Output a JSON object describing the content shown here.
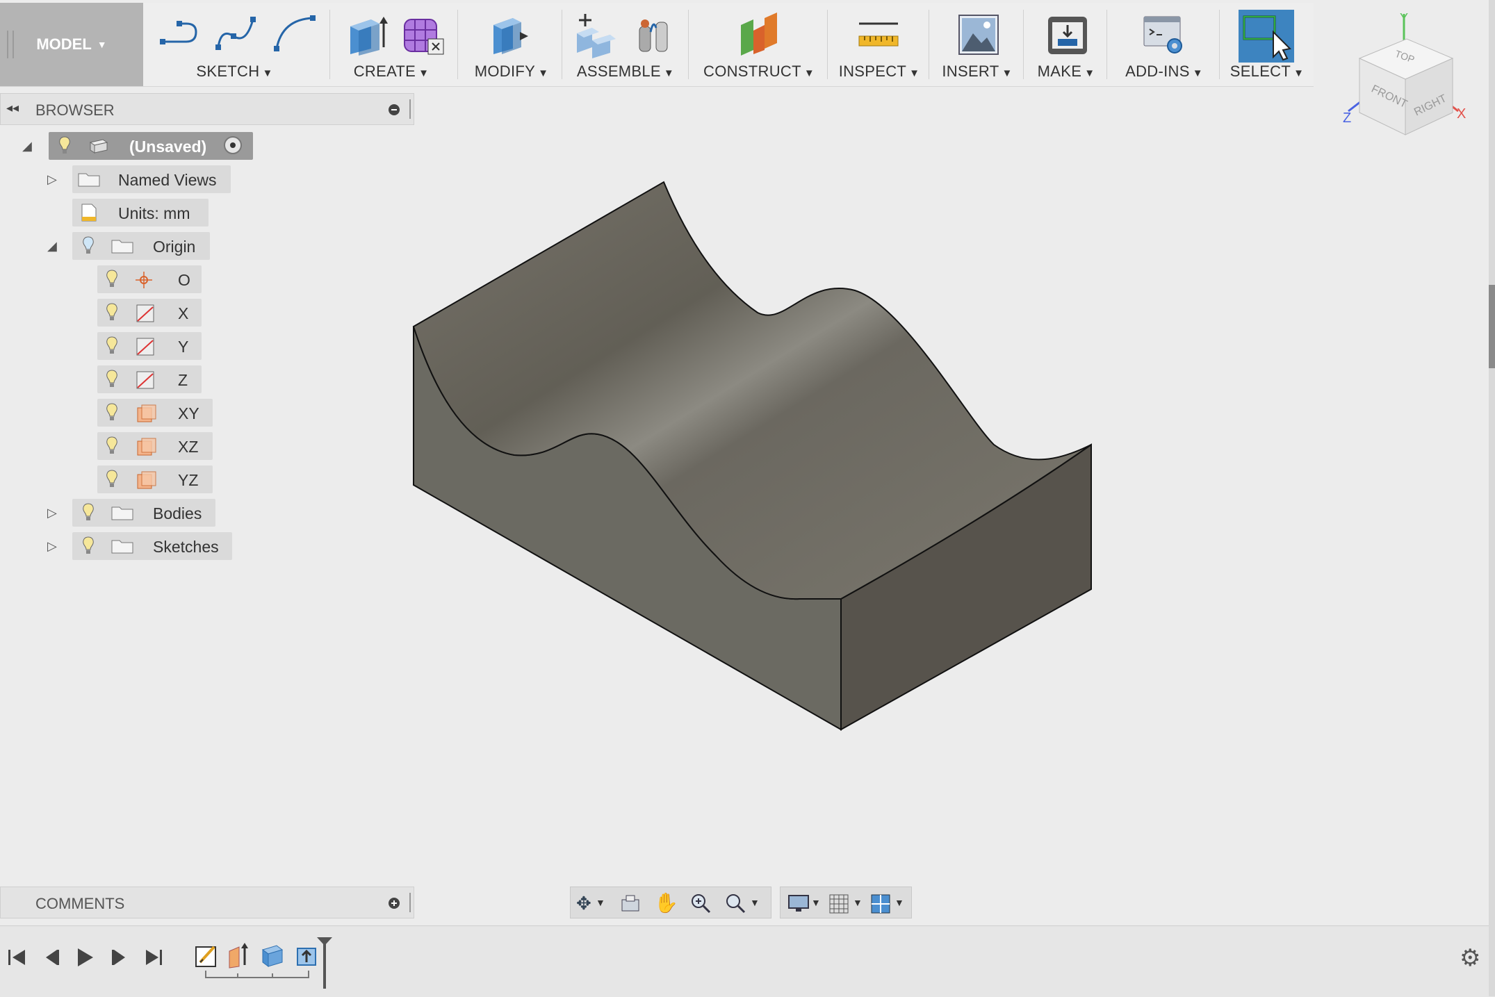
{
  "toolbar": {
    "workspace": "MODEL",
    "groups": [
      {
        "label": "SKETCH"
      },
      {
        "label": "CREATE"
      },
      {
        "label": "MODIFY"
      },
      {
        "label": "ASSEMBLE"
      },
      {
        "label": "CONSTRUCT"
      },
      {
        "label": "INSPECT"
      },
      {
        "label": "INSERT"
      },
      {
        "label": "MAKE"
      },
      {
        "label": "ADD-INS"
      },
      {
        "label": "SELECT"
      }
    ]
  },
  "browser": {
    "title": "BROWSER",
    "root": "(Unsaved)",
    "named_views": "Named Views",
    "units": "Units: mm",
    "origin": "Origin",
    "origin_items": [
      "O",
      "X",
      "Y",
      "Z",
      "XY",
      "XZ",
      "YZ"
    ],
    "bodies": "Bodies",
    "sketches": "Sketches"
  },
  "comments": {
    "title": "COMMENTS"
  },
  "viewcube": {
    "top": "TOP",
    "front": "FRONT",
    "right": "RIGHT",
    "axis_x": "X",
    "axis_y": "Y",
    "axis_z": "Z"
  },
  "colors": {
    "accent": "#3d84c0",
    "model_face_top": "#6f6b62",
    "model_face_side": "#5a5750",
    "model_face_front": "#6b6a62"
  }
}
